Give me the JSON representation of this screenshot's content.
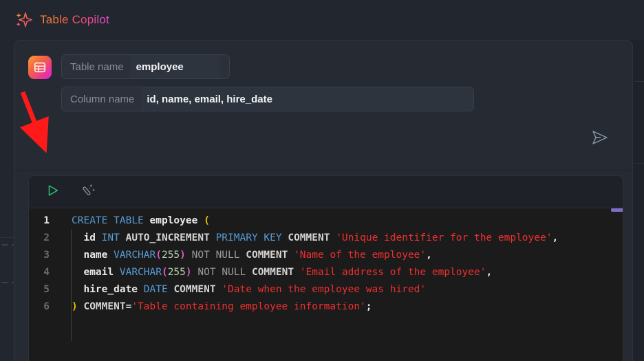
{
  "window": {
    "title": "Table Copilot",
    "title_icon": "sparkle-icon",
    "accent_gradient_from": "#f58a3c",
    "accent_gradient_to": "#e44bd4",
    "background": "#22262e",
    "panel_background": "#262a33"
  },
  "prompt": {
    "app_icon": "table-grid-icon",
    "fields": [
      {
        "label": "Table name",
        "value": "employee",
        "placeholder": "Table name"
      },
      {
        "label": "Column name",
        "value": "id, name, email, hire_date",
        "placeholder": "Column name"
      }
    ],
    "send_button": {
      "icon": "send-paper-plane-icon",
      "label": "Send"
    }
  },
  "editor": {
    "toolbar": [
      {
        "icon": "run-play-icon",
        "label": "Run",
        "color": "#2dbd75"
      },
      {
        "icon": "magic-wand-icon",
        "label": "Format",
        "color": "#8a93a3"
      }
    ],
    "scrollbar": {
      "orientation": "horizontal",
      "thumb_color": "#7a6fc3"
    },
    "language": "sql",
    "lines": [
      {
        "number": "1",
        "active": true,
        "tokens": [
          {
            "t": "CREATE",
            "c": "kw"
          },
          {
            "t": " ",
            "c": "plain"
          },
          {
            "t": "TABLE",
            "c": "kw"
          },
          {
            "t": " ",
            "c": "plain"
          },
          {
            "t": "employee",
            "c": "id"
          },
          {
            "t": " ",
            "c": "plain"
          },
          {
            "t": "(",
            "c": "paren-y"
          }
        ]
      },
      {
        "number": "2",
        "active": false,
        "tokens": [
          {
            "t": "  ",
            "c": "plain"
          },
          {
            "t": "id",
            "c": "id"
          },
          {
            "t": " ",
            "c": "plain"
          },
          {
            "t": "INT",
            "c": "kw"
          },
          {
            "t": " ",
            "c": "plain"
          },
          {
            "t": "AUTO_INCREMENT",
            "c": "plain"
          },
          {
            "t": " ",
            "c": "plain"
          },
          {
            "t": "PRIMARY",
            "c": "kw"
          },
          {
            "t": " ",
            "c": "plain"
          },
          {
            "t": "KEY",
            "c": "kw"
          },
          {
            "t": " ",
            "c": "plain"
          },
          {
            "t": "COMMENT",
            "c": "plain"
          },
          {
            "t": " ",
            "c": "plain"
          },
          {
            "t": "'Unique identifier for the employee'",
            "c": "str"
          },
          {
            "t": ",",
            "c": "punct"
          }
        ]
      },
      {
        "number": "3",
        "active": false,
        "tokens": [
          {
            "t": "  ",
            "c": "plain"
          },
          {
            "t": "name",
            "c": "id"
          },
          {
            "t": " ",
            "c": "plain"
          },
          {
            "t": "VARCHAR",
            "c": "kw"
          },
          {
            "t": "(",
            "c": "paren-m"
          },
          {
            "t": "255",
            "c": "num"
          },
          {
            "t": ")",
            "c": "paren-m"
          },
          {
            "t": " ",
            "c": "plain"
          },
          {
            "t": "NOT",
            "c": "dim"
          },
          {
            "t": " ",
            "c": "plain"
          },
          {
            "t": "NULL",
            "c": "dim"
          },
          {
            "t": " ",
            "c": "plain"
          },
          {
            "t": "COMMENT",
            "c": "plain"
          },
          {
            "t": " ",
            "c": "plain"
          },
          {
            "t": "'Name of the employee'",
            "c": "str"
          },
          {
            "t": ",",
            "c": "punct"
          }
        ]
      },
      {
        "number": "4",
        "active": false,
        "tokens": [
          {
            "t": "  ",
            "c": "plain"
          },
          {
            "t": "email",
            "c": "id"
          },
          {
            "t": " ",
            "c": "plain"
          },
          {
            "t": "VARCHAR",
            "c": "kw"
          },
          {
            "t": "(",
            "c": "paren-m"
          },
          {
            "t": "255",
            "c": "num"
          },
          {
            "t": ")",
            "c": "paren-m"
          },
          {
            "t": " ",
            "c": "plain"
          },
          {
            "t": "NOT",
            "c": "dim"
          },
          {
            "t": " ",
            "c": "plain"
          },
          {
            "t": "NULL",
            "c": "dim"
          },
          {
            "t": " ",
            "c": "plain"
          },
          {
            "t": "COMMENT",
            "c": "plain"
          },
          {
            "t": " ",
            "c": "plain"
          },
          {
            "t": "'Email address of the employee'",
            "c": "str"
          },
          {
            "t": ",",
            "c": "punct"
          }
        ]
      },
      {
        "number": "5",
        "active": false,
        "tokens": [
          {
            "t": "  ",
            "c": "plain"
          },
          {
            "t": "hire_date",
            "c": "id"
          },
          {
            "t": " ",
            "c": "plain"
          },
          {
            "t": "DATE",
            "c": "kw"
          },
          {
            "t": " ",
            "c": "plain"
          },
          {
            "t": "COMMENT",
            "c": "plain"
          },
          {
            "t": " ",
            "c": "plain"
          },
          {
            "t": "'Date when the employee was hired'",
            "c": "str"
          }
        ]
      },
      {
        "number": "6",
        "active": false,
        "tokens": [
          {
            "t": ")",
            "c": "paren-y"
          },
          {
            "t": " ",
            "c": "plain"
          },
          {
            "t": "COMMENT=",
            "c": "plain"
          },
          {
            "t": "'Table containing employee information'",
            "c": "str"
          },
          {
            "t": ";",
            "c": "punct"
          }
        ]
      }
    ]
  },
  "annotation": {
    "type": "arrow",
    "color": "#ff1a1a",
    "points_to": "run-play-icon"
  }
}
